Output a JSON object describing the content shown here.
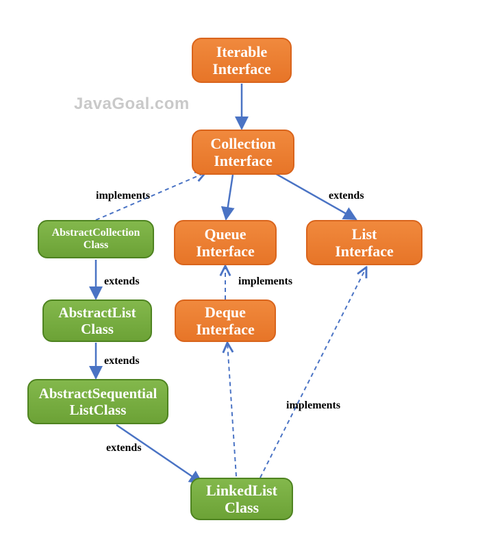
{
  "watermark": "JavaGoal.com",
  "nodes": {
    "iterable": {
      "line1": "Iterable",
      "line2": "Interface"
    },
    "collection": {
      "line1": "Collection",
      "line2": "Interface"
    },
    "abstractcollection": {
      "line1": "AbstractCollection",
      "line2": "Class"
    },
    "queue": {
      "line1": "Queue",
      "line2": "Interface"
    },
    "list": {
      "line1": "List",
      "line2": "Interface"
    },
    "abstractlist": {
      "line1": "AbstractList",
      "line2": "Class"
    },
    "deque": {
      "line1": "Deque",
      "line2": "Interface"
    },
    "abstractsequential": {
      "line1": "AbstractSequential",
      "line2": "ListClass"
    },
    "linkedlist": {
      "line1": "LinkedList",
      "line2": "Class"
    }
  },
  "labels": {
    "implements1": "implements",
    "extends1": "extends",
    "extends2": "extends",
    "implements2": "implements",
    "extends3": "extends",
    "implements3": "implements",
    "extends4": "extends"
  },
  "chart_data": {
    "type": "hierarchy",
    "title": "Java LinkedList class hierarchy",
    "nodes": [
      {
        "id": "Iterable",
        "kind": "interface"
      },
      {
        "id": "Collection",
        "kind": "interface"
      },
      {
        "id": "AbstractCollection",
        "kind": "class"
      },
      {
        "id": "Queue",
        "kind": "interface"
      },
      {
        "id": "List",
        "kind": "interface"
      },
      {
        "id": "AbstractList",
        "kind": "class"
      },
      {
        "id": "Deque",
        "kind": "interface"
      },
      {
        "id": "AbstractSequentialList",
        "kind": "class"
      },
      {
        "id": "LinkedList",
        "kind": "class"
      }
    ],
    "edges": [
      {
        "from": "Iterable",
        "to": "Collection",
        "relation": "extends"
      },
      {
        "from": "Collection",
        "to": "Queue",
        "relation": "extends"
      },
      {
        "from": "Collection",
        "to": "List",
        "relation": "extends"
      },
      {
        "from": "AbstractCollection",
        "to": "Collection",
        "relation": "implements"
      },
      {
        "from": "AbstractList",
        "to": "AbstractCollection",
        "relation": "extends"
      },
      {
        "from": "Deque",
        "to": "Queue",
        "relation": "implements"
      },
      {
        "from": "AbstractSequentialList",
        "to": "AbstractList",
        "relation": "extends"
      },
      {
        "from": "LinkedList",
        "to": "AbstractSequentialList",
        "relation": "extends"
      },
      {
        "from": "LinkedList",
        "to": "Deque",
        "relation": "implements"
      },
      {
        "from": "LinkedList",
        "to": "List",
        "relation": "implements"
      }
    ]
  }
}
